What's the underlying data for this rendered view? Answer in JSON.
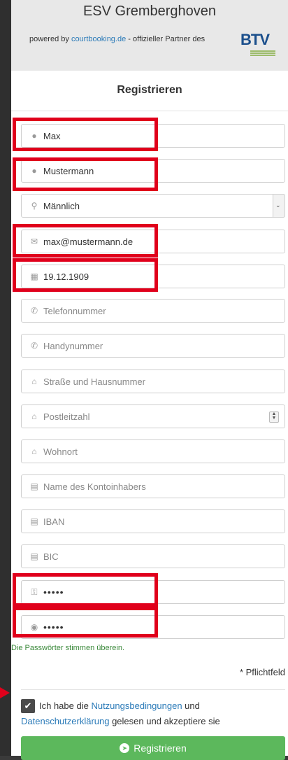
{
  "header": {
    "club_name": "ESV Gremberghoven",
    "powered_prefix": "powered by ",
    "powered_link": "courtbooking.de",
    "powered_suffix": " - offizieller Partner des",
    "partner_logo_text": "BTV"
  },
  "form": {
    "title": "Registrieren",
    "fields": [
      {
        "icon": "user-icon",
        "value": "Max"
      },
      {
        "icon": "user-icon",
        "value": "Mustermann"
      },
      {
        "icon": "gender-icon",
        "value": "Männlich"
      },
      {
        "icon": "envelope-icon",
        "value": "max@mustermann.de"
      },
      {
        "icon": "calendar-icon",
        "value": "19.12.1909"
      },
      {
        "icon": "phone-icon",
        "placeholder": "Telefonnummer"
      },
      {
        "icon": "phone-icon",
        "placeholder": "Handynummer"
      },
      {
        "icon": "home-icon",
        "placeholder": "Straße und Hausnummer"
      },
      {
        "icon": "home-icon",
        "placeholder": "Postleitzahl"
      },
      {
        "icon": "home-icon",
        "placeholder": "Wohnort"
      },
      {
        "icon": "credit-card-icon",
        "placeholder": "Name des Kontoinhabers"
      },
      {
        "icon": "credit-card-icon",
        "placeholder": "IBAN"
      },
      {
        "icon": "credit-card-icon",
        "placeholder": "BIC"
      },
      {
        "icon": "key-icon",
        "value": "•••••"
      },
      {
        "icon": "eye-icon",
        "value": "•••••"
      }
    ],
    "password_match": "Die Passwörter stimmen überein.",
    "required_note": "* Pflichtfeld",
    "terms": {
      "prefix": "Ich habe die ",
      "link1": "Nutzungsbedingungen",
      "middle": " und",
      "link2": "Datenschutzerklärung",
      "suffix": " gelesen und akzeptiere sie",
      "checked": true
    },
    "submit_label": "Registrieren"
  },
  "colors": {
    "highlight": "#e0001b",
    "button": "#5cb85c",
    "link": "#2a7ab8",
    "success_text": "#3c8a3c"
  }
}
